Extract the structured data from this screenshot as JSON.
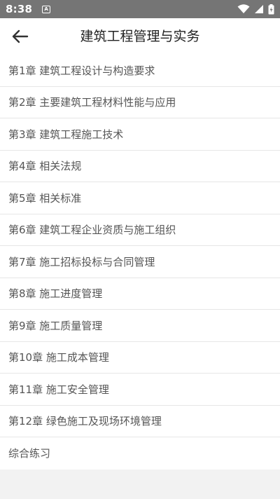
{
  "status_bar": {
    "time": "8:38",
    "app_icon_letter": "A",
    "icons": [
      "wifi-icon",
      "signal-icon",
      "battery-icon"
    ]
  },
  "header": {
    "title": "建筑工程管理与实务",
    "back_icon": "arrow-left-icon"
  },
  "colors": {
    "status_bar": "#757575",
    "app_bar": "#ffffff",
    "text_primary": "#222222",
    "text_item": "#555555",
    "divider": "#e6e6e6",
    "background": "#f2f2f2"
  },
  "chapters": [
    {
      "label": "第1章 建筑工程设计与构造要求"
    },
    {
      "label": "第2章 主要建筑工程材料性能与应用"
    },
    {
      "label": "第3章 建筑工程施工技术"
    },
    {
      "label": "第4章 相关法规"
    },
    {
      "label": "第5章 相关标准"
    },
    {
      "label": "第6章 建筑工程企业资质与施工组织"
    },
    {
      "label": "第7章 施工招标投标与合同管理"
    },
    {
      "label": "第8章 施工进度管理"
    },
    {
      "label": "第9章 施工质量管理"
    },
    {
      "label": "第10章 施工成本管理"
    },
    {
      "label": "第11章 施工安全管理"
    },
    {
      "label": "第12章 绿色施工及现场环境管理"
    },
    {
      "label": "综合练习"
    }
  ]
}
